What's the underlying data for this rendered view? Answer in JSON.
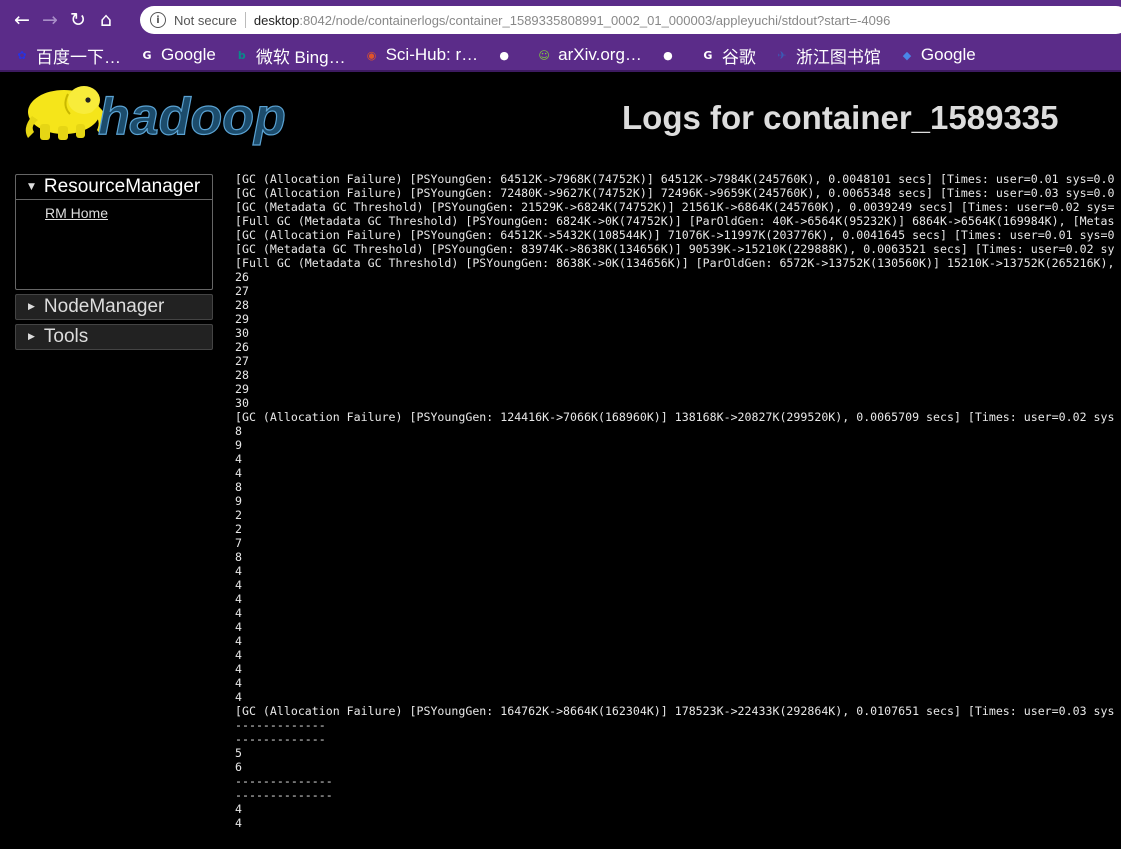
{
  "browser": {
    "not_secure": "Not secure",
    "url_host": "desktop",
    "url_path": ":8042/node/containerlogs/container_1589335808991_0002_01_000003/appleyuchi/stdout?start=-4096",
    "bookmarks": [
      {
        "label": "百度一下…",
        "icon": "baidu-icon",
        "color": "#2932e1"
      },
      {
        "label": "Google",
        "icon": "google-icon",
        "color": "#ffffff"
      },
      {
        "label": "微软 Bing…",
        "icon": "bing-icon",
        "color": "#0a8a8a"
      },
      {
        "label": "Sci-Hub: r…",
        "icon": "scihub-icon",
        "color": "#e0542a"
      },
      {
        "label": "",
        "icon": "globe-icon",
        "color": "#ffffff"
      },
      {
        "label": "arXiv.org…",
        "icon": "arxiv-icon",
        "color": "#7fd13b"
      },
      {
        "label": "",
        "icon": "globe-icon",
        "color": "#ffffff"
      },
      {
        "label": "谷歌",
        "icon": "google-icon",
        "color": "#ffffff"
      },
      {
        "label": "浙江图书馆",
        "icon": "library-icon",
        "color": "#3b5bb5"
      },
      {
        "label": "Google",
        "icon": "translate-icon",
        "color": "#4a86e8"
      }
    ]
  },
  "page": {
    "logo_text": "hadoop",
    "title": "Logs for container_1589335"
  },
  "sidebar": {
    "sections": [
      {
        "label": "ResourceManager",
        "state": "open",
        "links": [
          "RM Home"
        ]
      },
      {
        "label": "NodeManager",
        "state": "closed"
      },
      {
        "label": "Tools",
        "state": "closed"
      }
    ]
  },
  "log_lines": [
    "[GC (Allocation Failure) [PSYoungGen: 64512K->7968K(74752K)] 64512K->7984K(245760K), 0.0048101 secs] [Times: user=0.01 sys=0.0",
    "[GC (Allocation Failure) [PSYoungGen: 72480K->9627K(74752K)] 72496K->9659K(245760K), 0.0065348 secs] [Times: user=0.03 sys=0.0",
    "[GC (Metadata GC Threshold) [PSYoungGen: 21529K->6824K(74752K)] 21561K->6864K(245760K), 0.0039249 secs] [Times: user=0.02 sys=",
    "[Full GC (Metadata GC Threshold) [PSYoungGen: 6824K->0K(74752K)] [ParOldGen: 40K->6564K(95232K)] 6864K->6564K(169984K), [Metas",
    "[GC (Allocation Failure) [PSYoungGen: 64512K->5432K(108544K)] 71076K->11997K(203776K), 0.0041645 secs] [Times: user=0.01 sys=0",
    "[GC (Metadata GC Threshold) [PSYoungGen: 83974K->8638K(134656K)] 90539K->15210K(229888K), 0.0063521 secs] [Times: user=0.02 sy",
    "[Full GC (Metadata GC Threshold) [PSYoungGen: 8638K->0K(134656K)] [ParOldGen: 6572K->13752K(130560K)] 15210K->13752K(265216K),",
    "26",
    "27",
    "28",
    "29",
    "30",
    "26",
    "27",
    "28",
    "29",
    "30",
    "[GC (Allocation Failure) [PSYoungGen: 124416K->7066K(168960K)] 138168K->20827K(299520K), 0.0065709 secs] [Times: user=0.02 sys",
    "8",
    "9",
    "4",
    "4",
    "8",
    "9",
    "2",
    "2",
    "7",
    "8",
    "4",
    "4",
    "4",
    "4",
    "4",
    "4",
    "4",
    "4",
    "4",
    "4",
    "[GC (Allocation Failure) [PSYoungGen: 164762K->8664K(162304K)] 178523K->22433K(292864K), 0.0107651 secs] [Times: user=0.03 sys",
    "-------------",
    "-------------",
    "5",
    "6",
    "--------------",
    "--------------",
    "4",
    "4"
  ]
}
